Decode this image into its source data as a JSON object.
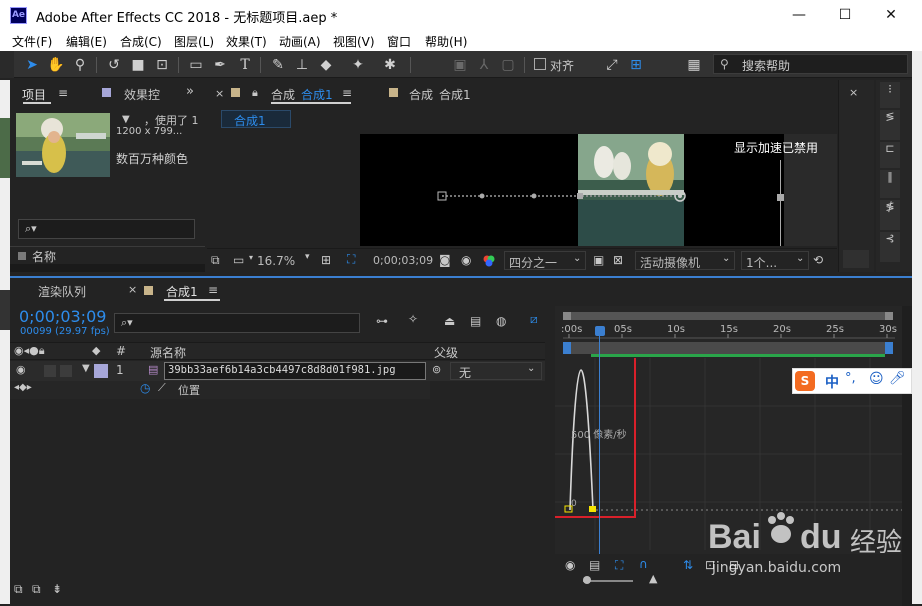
{
  "window": {
    "app_icon": "Ae",
    "title": "Adobe After Effects CC 2018 - 无标题项目.aep *",
    "minimize": "—",
    "maximize": "☐",
    "close": "✕"
  },
  "menu": [
    "文件(F)",
    "编辑(E)",
    "合成(C)",
    "图层(L)",
    "效果(T)",
    "动画(A)",
    "视图(V)",
    "窗口",
    "帮助(H)"
  ],
  "toolbar": {
    "snap_label": "对齐",
    "search_placeholder": "搜索帮助"
  },
  "project_panel": {
    "tab_project": "项目",
    "tab_effects": "效果控",
    "used_label": "，使用了 1",
    "dimensions": "1200 x 799...",
    "color_depth": "数百万种颜色",
    "column_name": "名称",
    "search_icon": "⌕▾"
  },
  "comp_panel": {
    "tab1_prefix": "合成",
    "tab1_name": "合成1",
    "tab2_prefix": "合成",
    "tab2_name": "合成1",
    "breadcrumb": "合成1",
    "gpu_notice": "显示加速已禁用",
    "zoom": "16.7%",
    "timecode": "0;00;03;09",
    "resolution": "四分之一",
    "camera": "活动摄像机",
    "views": "1个..."
  },
  "timeline": {
    "tab_render": "渲染队列",
    "tab_comp": "合成1",
    "timecode": "0;00;03;09",
    "frames_fps": "00099 (29.97 fps)",
    "col_num": "#",
    "col_source": "源名称",
    "col_parent": "父级",
    "layer_index": "1",
    "layer_name": "39bb33aef6b14a3cb4497c8d8d01f981.jpg",
    "parent_value": "无",
    "property_name": "位置",
    "ruler_ticks": [
      ":00s",
      "05s",
      "10s",
      "15s",
      "20s",
      "25s",
      "30s"
    ],
    "graph_label_top": "500 像素/秒",
    "graph_label_bottom": "0"
  },
  "ime": {
    "label": "中",
    "extras": "°,"
  },
  "watermark": {
    "brand": "Bai",
    "brand2": "du",
    "cn": "经验",
    "url": "jingyan.baidu.com"
  },
  "colors": {
    "accent_blue": "#2d8ceb",
    "keyframe_yellow": "#f5e400",
    "highlight_red": "#d9202a",
    "work_area_green": "#2aa54a"
  }
}
